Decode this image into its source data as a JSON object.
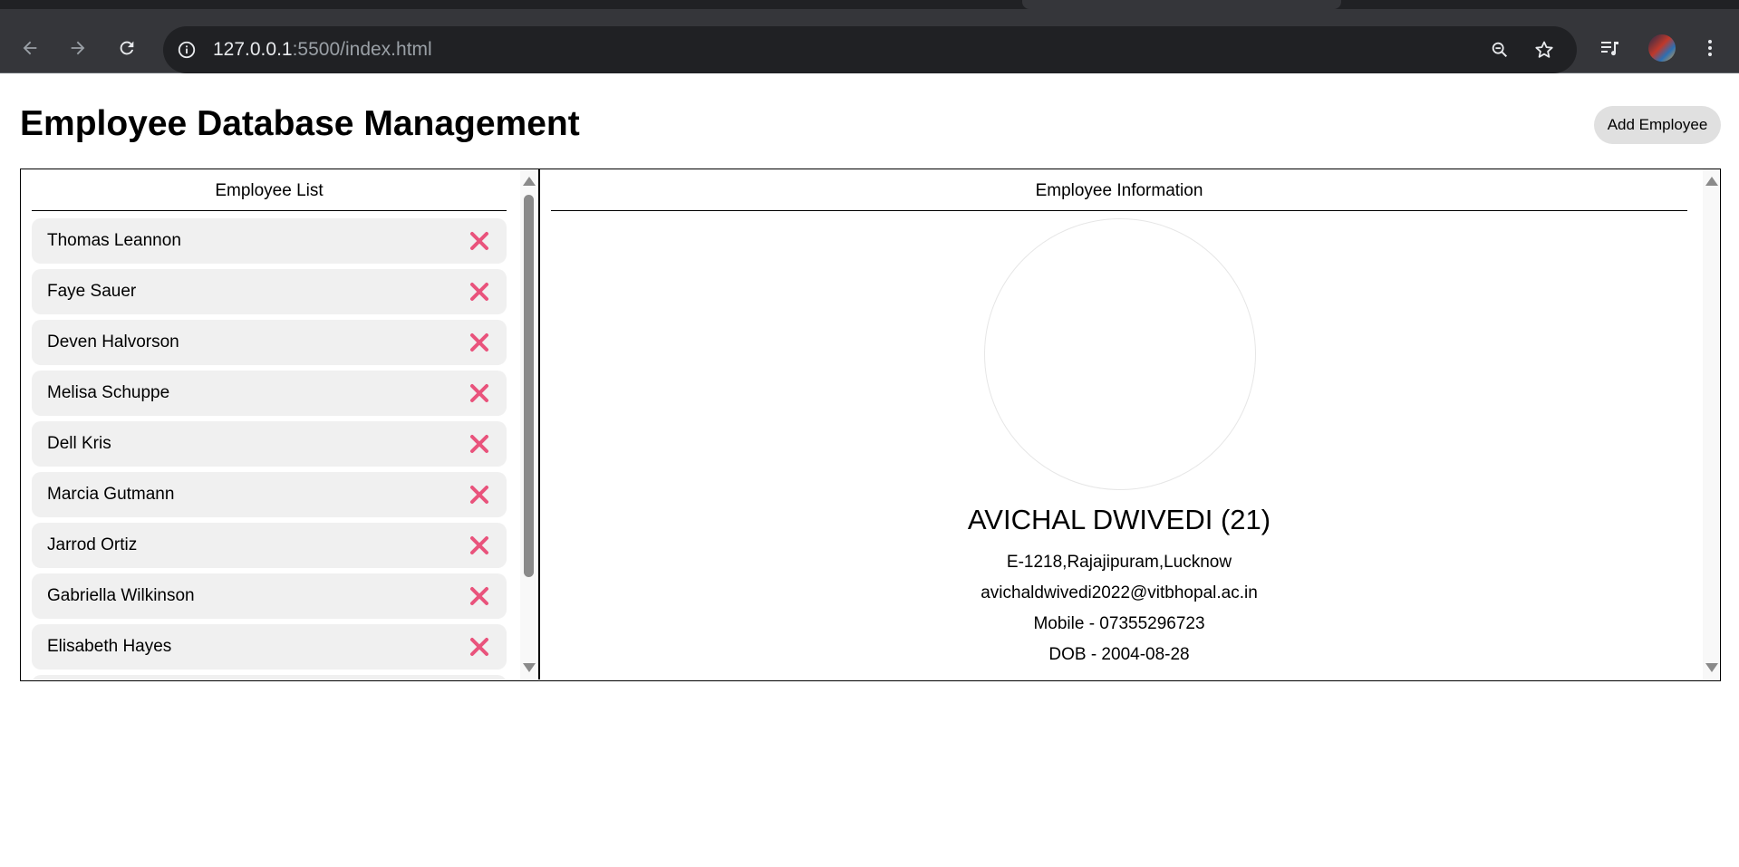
{
  "browser": {
    "url_host": "127.0.0.1",
    "url_rest": ":5500/index.html",
    "icons": [
      "back-icon",
      "forward-icon",
      "reload-icon",
      "site-info-icon",
      "zoom-icon",
      "bookmark-star-icon",
      "media-control-icon",
      "profile-avatar",
      "more-menu-icon"
    ]
  },
  "page": {
    "title": "Employee Database Management",
    "add_button": "Add Employee"
  },
  "list_panel": {
    "heading": "Employee List",
    "employees": [
      "Thomas Leannon",
      "Faye Sauer",
      "Deven Halvorson",
      "Melisa Schuppe",
      "Dell Kris",
      "Marcia Gutmann",
      "Jarrod Ortiz",
      "Gabriella Wilkinson",
      "Elisabeth Hayes"
    ],
    "delete_icon": "delete-x-icon",
    "delete_color": "#e9537c"
  },
  "info_panel": {
    "heading": "Employee Information",
    "name": "AVICHAL DWIVEDI (21)",
    "address": "E-1218,Rajajipuram,Lucknow",
    "email": "avichaldwivedi2022@vitbhopal.ac.in",
    "mobile": "Mobile - 07355296723",
    "dob": "DOB - 2004-08-28"
  }
}
